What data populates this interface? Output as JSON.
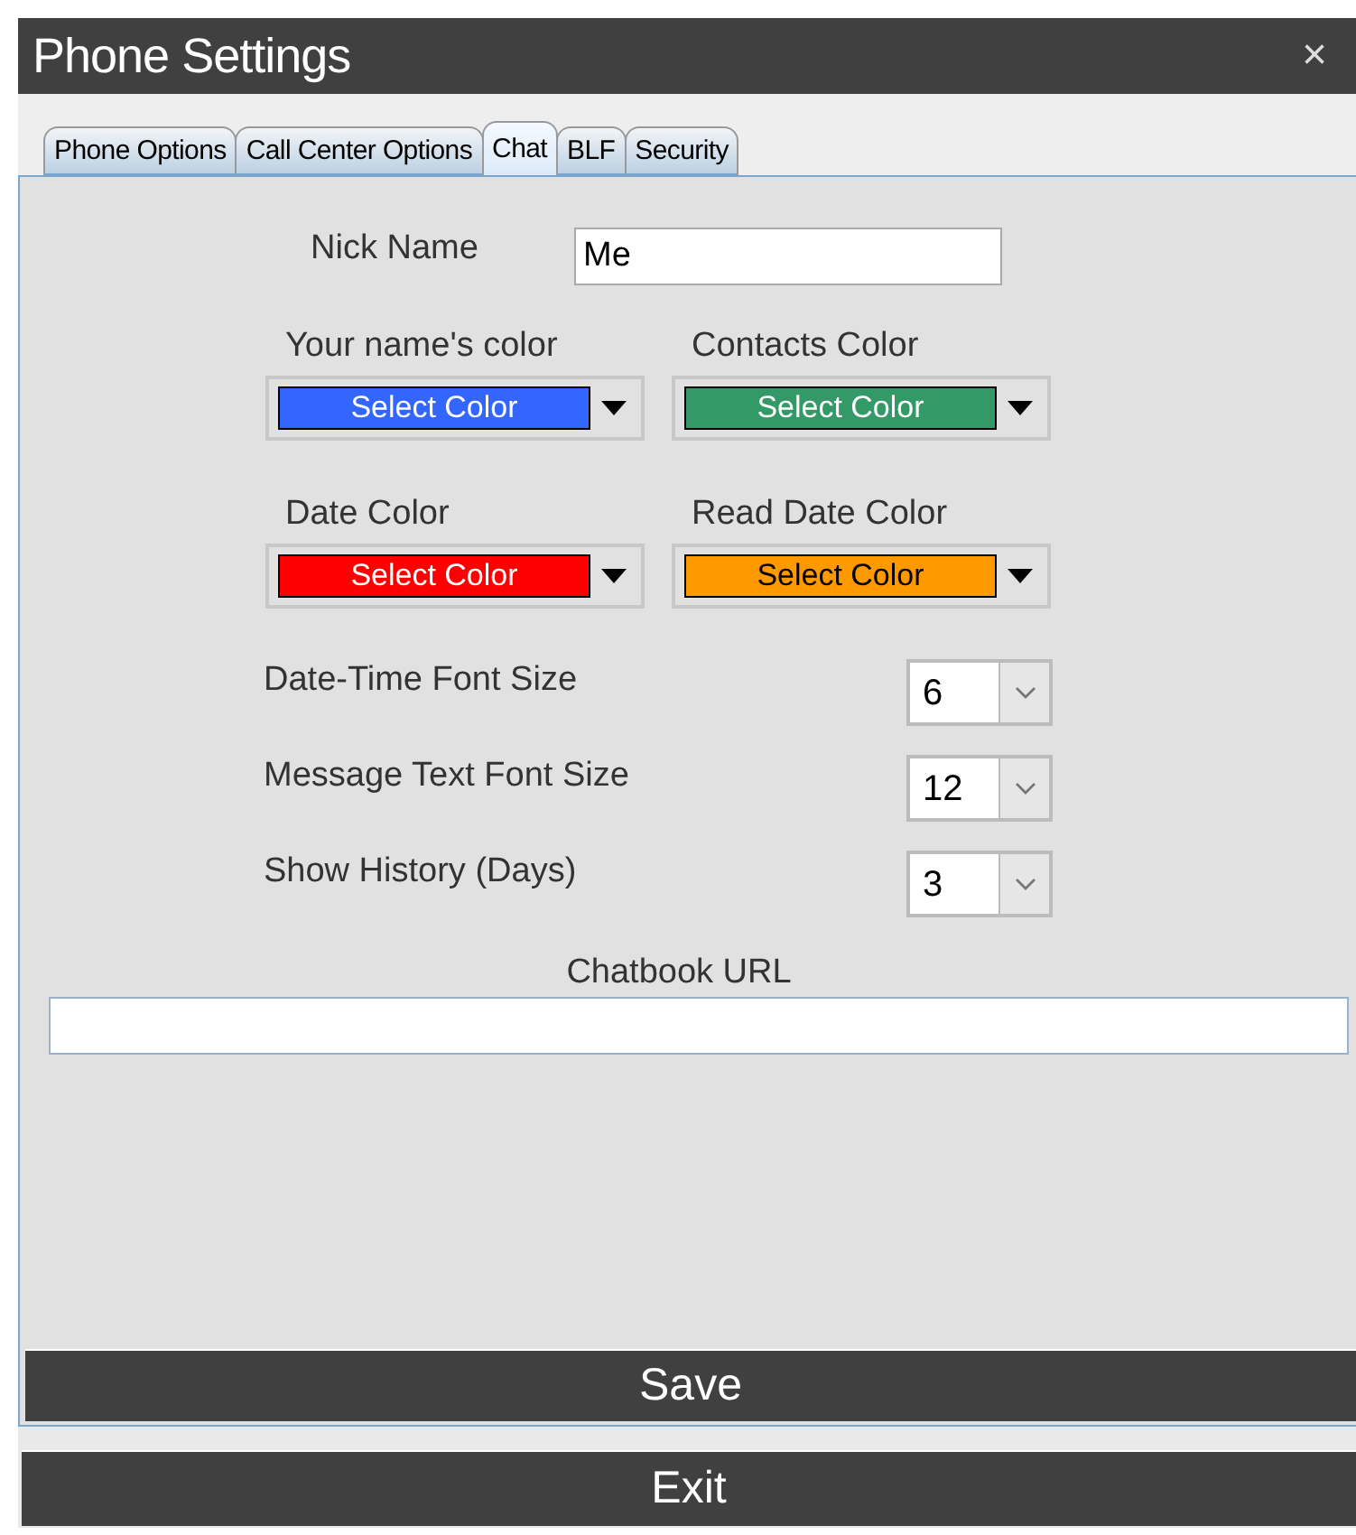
{
  "window": {
    "title": "Phone Settings",
    "close": "×"
  },
  "tabs": [
    {
      "label": "Phone Options",
      "selected": false
    },
    {
      "label": "Call Center Options",
      "selected": false
    },
    {
      "label": "Chat",
      "selected": true
    },
    {
      "label": "BLF",
      "selected": false
    },
    {
      "label": "Security",
      "selected": false
    }
  ],
  "nick_name": {
    "label": "Nick Name",
    "value": "Me"
  },
  "color_pickers": [
    {
      "label": "Your name's color",
      "button": "Select Color",
      "color": "#3366ff"
    },
    {
      "label": "Contacts Color",
      "button": "Select Color",
      "color": "#339966"
    },
    {
      "label": "Date Color",
      "button": "Select Color",
      "color": "#ff0000"
    },
    {
      "label": "Read Date Color",
      "button": "Select Color",
      "color": "#ff9900"
    }
  ],
  "font_settings": [
    {
      "label": "Date-Time Font Size",
      "value": "6"
    },
    {
      "label": "Message Text Font Size",
      "value": "12"
    },
    {
      "label": "Show History (Days)",
      "value": "3"
    }
  ],
  "chatbook_url": {
    "label": "Chatbook URL"
  },
  "buttons": {
    "save": "Save",
    "exit": "Exit"
  }
}
